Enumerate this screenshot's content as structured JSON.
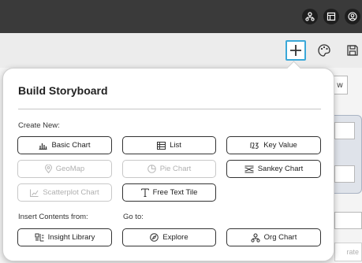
{
  "popup": {
    "title": "Build Storyboard",
    "create_new_label": "Create New:",
    "insert_label": "Insert Contents from:",
    "goto_label": "Go to:",
    "buttons": {
      "basic_chart": "Basic Chart",
      "list": "List",
      "key_value": "Key Value",
      "geomap": "GeoMap",
      "pie_chart": "Pie Chart",
      "sankey_chart": "Sankey Chart",
      "scatterplot_chart": "Scatterplot Chart",
      "free_text_tile": "Free Text Tile",
      "insight_library": "Insight Library",
      "explore": "Explore",
      "org_chart": "Org Chart"
    }
  },
  "background": {
    "right_button_fragment": "w",
    "bottom_fragment": "rate"
  },
  "colors": {
    "topbar": "#3a3a3a",
    "toolbar": "#ececec",
    "accent": "#3aa8d8",
    "disabled": "#b0b0b0"
  }
}
